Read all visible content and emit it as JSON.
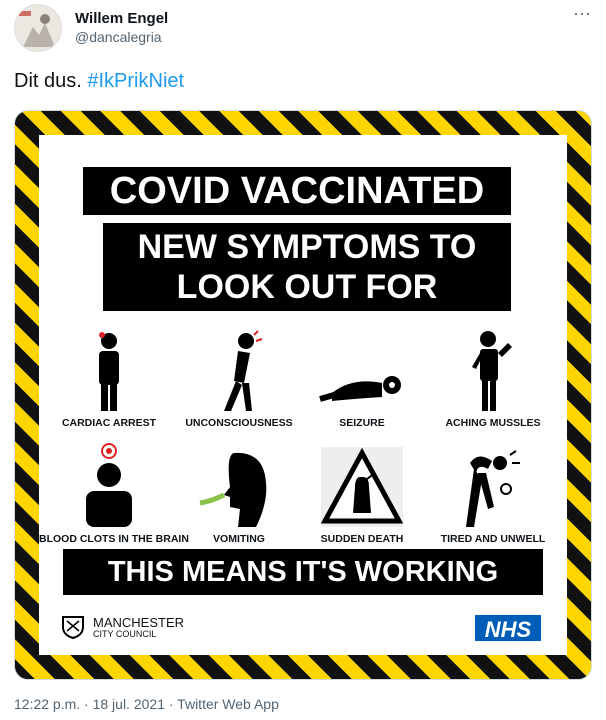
{
  "author": {
    "name": "Willem Engel",
    "handle": "@dancalegria"
  },
  "tweet": {
    "text": "Dit dus.",
    "hashtag": "#IkPrikNiet"
  },
  "poster": {
    "title": "COVID VACCINATED",
    "subtitle_line1": "NEW SYMPTOMS TO",
    "subtitle_line2": "LOOK OUT FOR",
    "symptoms": [
      "CARDIAC ARREST",
      "UNCONSCIOUSNESS",
      "SEIZURE",
      "ACHING MUSSLES",
      "BLOOD CLOTS IN THE BRAIN",
      "VOMITING",
      "SUDDEN DEATH",
      "TIRED AND UNWELL"
    ],
    "banner": "THIS MEANS IT'S WORKING",
    "council_line1": "MANCHESTER",
    "council_line2": "CITY COUNCIL",
    "nhs_logo": "NHS"
  },
  "meta": {
    "timestamp": "12:22 p.m. · 18 jul. 2021 · Twitter Web App"
  },
  "icons": {
    "more": "more-options-icon"
  }
}
